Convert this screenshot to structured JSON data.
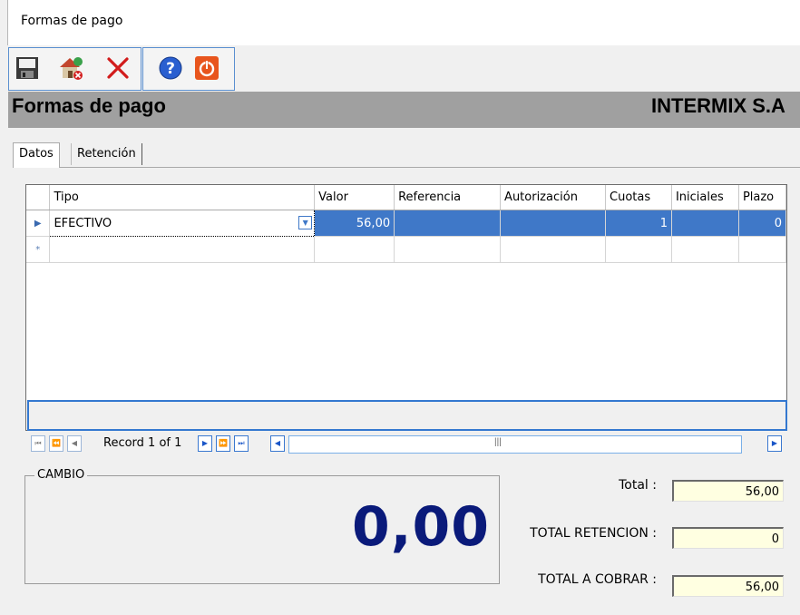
{
  "window": {
    "title": "Formas de pago"
  },
  "toolbar": {
    "buttons": [
      {
        "name": "save",
        "icon": "floppy-disk-icon"
      },
      {
        "name": "edit-house",
        "icon": "house-edit-icon"
      },
      {
        "name": "cancel",
        "icon": "red-x-icon"
      },
      {
        "name": "help",
        "icon": "question-circle-icon"
      },
      {
        "name": "exit",
        "icon": "power-icon"
      }
    ]
  },
  "header": {
    "title": "Formas de pago",
    "company": "INTERMIX S.A"
  },
  "tabs": [
    {
      "label": "Datos"
    },
    {
      "label": "Retención"
    }
  ],
  "grid": {
    "columns": [
      "Tipo",
      "Valor",
      "Referencia",
      "Autorización",
      "Cuotas",
      "Iniciales",
      "Plazo"
    ],
    "rows": [
      {
        "tipo": "EFECTIVO",
        "valor": "56,00",
        "referencia": "",
        "autorizacion": "",
        "cuotas": "1",
        "iniciales": "",
        "plazo": "0"
      }
    ],
    "new_row_marker": "*"
  },
  "navigator": {
    "record_text": "Record 1 of 1"
  },
  "cambio": {
    "label": "CAMBIO",
    "value": "0,00"
  },
  "totals": {
    "total_label": "Total :",
    "total_value": "56,00",
    "retencion_label": "TOTAL RETENCION :",
    "retencion_value": "0",
    "cobrar_label": "TOTAL A COBRAR :",
    "cobrar_value": "56,00"
  },
  "colors": {
    "selection": "#3f78c8",
    "cambio_value": "#0a1a7a",
    "input_bg": "#ffffe1",
    "header_band": "#a0a0a0"
  }
}
